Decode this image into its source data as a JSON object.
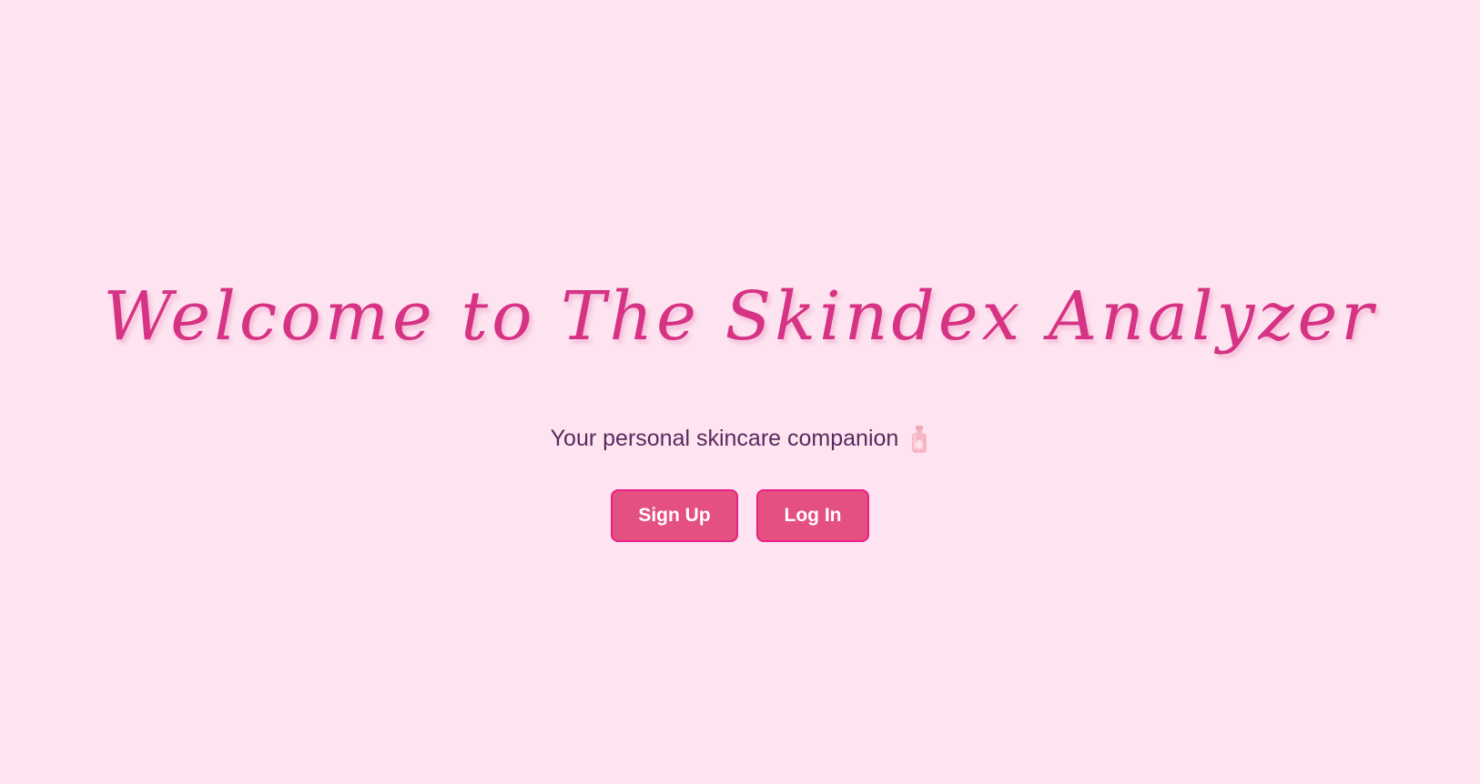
{
  "hero": {
    "title": "Welcome to The Skindex Analyzer",
    "subtitle": "Your personal skincare companion",
    "subtitle_icon": "lotion-bottle-icon"
  },
  "actions": {
    "signup_label": "Sign Up",
    "login_label": "Log In"
  },
  "colors": {
    "background": "#fde4f0",
    "title": "#d63384",
    "subtitle": "#5a2a5e",
    "button_fill": "#e4507f",
    "button_border": "#e8208a",
    "button_text": "#ffffff"
  }
}
